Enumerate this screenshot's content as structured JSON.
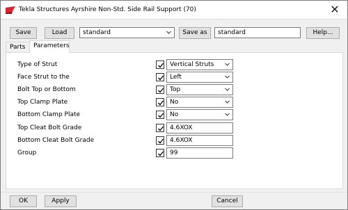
{
  "window": {
    "title": "Tekla Structures  Ayrshire Non-Std. Side Rail Support (70)",
    "close_glyph": "✕"
  },
  "toolbar": {
    "save_label": "Save",
    "load_label": "Load",
    "preset_value": "standard",
    "save_as_label": "Save as",
    "save_as_value": "standard",
    "help_label": "Help..."
  },
  "tabs": [
    {
      "label": "Parts",
      "active": false
    },
    {
      "label": "Parameters",
      "active": true
    }
  ],
  "parameters": [
    {
      "label": "Type of Strut",
      "checked": true,
      "type": "select",
      "value": "Vertical Struts"
    },
    {
      "label": "Face Strut to the",
      "checked": true,
      "type": "select",
      "value": "Left"
    },
    {
      "label": "Bolt Top or Bottom",
      "checked": true,
      "type": "select",
      "value": "Top"
    },
    {
      "label": "Top Clamp Plate",
      "checked": true,
      "type": "select",
      "value": "No"
    },
    {
      "label": "Bottom Clamp Plate",
      "checked": true,
      "type": "select",
      "value": "No"
    },
    {
      "label": "Top Cleat Bolt Grade",
      "checked": true,
      "type": "text",
      "value": "4.6XOX"
    },
    {
      "label": "Bottom Cleat Bolt Grade",
      "checked": true,
      "type": "text",
      "value": "4.6XOX"
    },
    {
      "label": "Group",
      "checked": true,
      "type": "text",
      "value": "99"
    }
  ],
  "footer": {
    "ok_label": "OK",
    "apply_label": "Apply",
    "cancel_label": "Cancel"
  },
  "icons": {
    "app": "tekla-logo-icon",
    "dropdown": "chevron-down-icon",
    "check": "checkmark-icon",
    "close": "close-icon"
  },
  "colors": {
    "brand_red": "#d9252b",
    "panel_bg": "#ffffff",
    "window_bg": "#f0f0f0"
  }
}
